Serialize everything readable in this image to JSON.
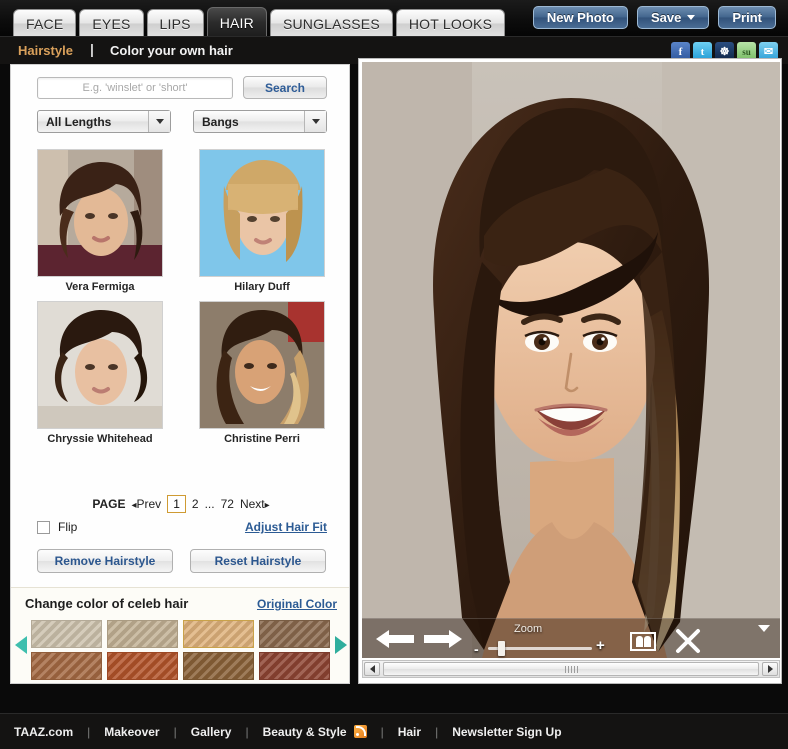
{
  "nav": {
    "tabs": [
      {
        "label": "FACE",
        "active": false
      },
      {
        "label": "EYES",
        "active": false
      },
      {
        "label": "LIPS",
        "active": false
      },
      {
        "label": "HAIR",
        "active": true
      },
      {
        "label": "SUNGLASSES",
        "active": false
      },
      {
        "label": "HOT LOOKS",
        "active": false
      }
    ],
    "actions": {
      "new_photo": "New Photo",
      "save": "Save",
      "print": "Print"
    }
  },
  "subheader": {
    "section": "Hairstyle",
    "separator": "|",
    "title": "Color your own hair",
    "socials": [
      {
        "name": "facebook-icon",
        "glyph": "f"
      },
      {
        "name": "twitter-icon",
        "glyph": "t"
      },
      {
        "name": "myspace-icon",
        "glyph": "☸"
      },
      {
        "name": "stumbleupon-icon",
        "glyph": "su"
      },
      {
        "name": "email-icon",
        "glyph": "✉"
      }
    ]
  },
  "search": {
    "placeholder": "E.g. 'winslet' or 'short'",
    "value": "",
    "button": "Search"
  },
  "filters": [
    {
      "name": "length-select",
      "value": "All Lengths"
    },
    {
      "name": "bangs-select",
      "value": "Bangs"
    }
  ],
  "gallery": {
    "items": [
      {
        "name": "Vera Fermiga",
        "hair": "#3c2417",
        "skin": "#e2b79a",
        "bg": "#bdb3a6"
      },
      {
        "name": "Hilary Duff",
        "hair": "#cfa564",
        "skin": "#e8c2a4",
        "bg": "#7ec4e8"
      },
      {
        "name": "Chryssie Whitehead",
        "hair": "#2e1c12",
        "skin": "#e6bc9e",
        "bg": "#ddd9d2"
      },
      {
        "name": "Christine Perri",
        "hair": "#33200f",
        "skin": "#d9a277",
        "bg": "#95836f"
      }
    ]
  },
  "pagination": {
    "label": "PAGE",
    "prev": "Prev",
    "next": "Next",
    "pages": [
      "1",
      "2",
      "...",
      "72"
    ],
    "current": "1"
  },
  "controls": {
    "flip_label": "Flip",
    "flip_checked": false,
    "adjust_link": "Adjust Hair Fit",
    "remove_button": "Remove Hairstyle",
    "reset_button": "Reset Hairstyle"
  },
  "color_section": {
    "title": "Change color of celeb hair",
    "original_link": "Original Color",
    "swatches_row1": [
      "#cdc2ad",
      "#c2b194",
      "#dfb27c",
      "#8a6a4e"
    ],
    "swatches_row2": [
      "#a56a43",
      "#b2532a",
      "#8a6238",
      "#8e4433"
    ],
    "selected_index": 2,
    "prev_arrow": "scroll-left",
    "next_arrow": "scroll-right"
  },
  "photo_toolbar": {
    "prev_arrow": "previous-hairstyle",
    "next_arrow": "next-hairstyle",
    "zoom_label": "Zoom",
    "zoom_minus": "-",
    "zoom_plus": "+",
    "compare_icon": "compare-faces-icon",
    "close_icon": "close-icon",
    "collapse_icon": "collapse-toolbar-icon"
  },
  "footer": {
    "links": [
      "TAAZ.com",
      "Makeover",
      "Gallery",
      "Beauty & Style",
      "Hair",
      "Newsletter Sign Up"
    ],
    "separator": "|",
    "rss_icon": "rss-icon"
  },
  "colors": {
    "accent_orange": "#d9a05b",
    "link_blue": "#2c5b94",
    "teal_arrow": "#3fbfae",
    "page_highlight": "#cf9b33"
  }
}
